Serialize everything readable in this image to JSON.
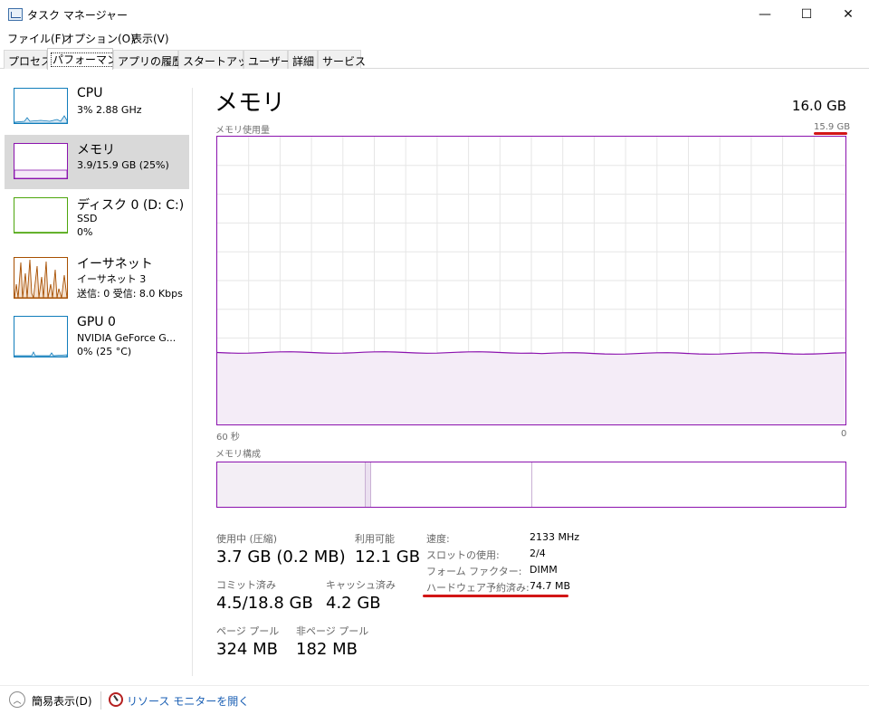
{
  "window": {
    "title": "タスク マネージャー",
    "minimize_glyph": "—",
    "maximize_glyph": "☐",
    "close_glyph": "✕"
  },
  "menu": [
    "ファイル(F)",
    "オプション(O)",
    "表示(V)"
  ],
  "tabs": [
    "プロセス",
    "パフォーマンス",
    "アプリの履歴",
    "スタートアップ",
    "ユーザー",
    "詳細",
    "サービス"
  ],
  "active_tab": "パフォーマンス",
  "sidebar": {
    "items": [
      {
        "title": "CPU",
        "sub1": "3%  2.88 GHz",
        "sub2": "",
        "sub3": "",
        "color": "#117dbb"
      },
      {
        "title": "メモリ",
        "sub1": "3.9/15.9 GB (25%)",
        "sub2": "",
        "sub3": "",
        "color": "#8b12ae"
      },
      {
        "title": "ディスク 0 (D: C:)",
        "sub1": "SSD",
        "sub2": "0%",
        "sub3": "",
        "color": "#4da60c"
      },
      {
        "title": "イーサネット",
        "sub1": "イーサネット 3",
        "sub2": "送信: 0  受信: 8.0 Kbps",
        "sub3": "",
        "color": "#a74f01"
      },
      {
        "title": "GPU 0",
        "sub1": "NVIDIA GeForce G...",
        "sub2": "0% (25 °C)",
        "sub3": "",
        "color": "#117dbb"
      }
    ]
  },
  "main": {
    "title": "メモリ",
    "total": "16.0 GB",
    "usage_label": "メモリ使用量",
    "usage_max": "15.9 GB",
    "x_left": "60 秒",
    "x_right": "0",
    "composition_label": "メモリ構成",
    "usage_fraction": 0.25
  },
  "stats": {
    "in_use_label": "使用中 (圧縮)",
    "in_use_value": "3.7 GB (0.2 MB)",
    "available_label": "利用可能",
    "available_value": "12.1 GB",
    "committed_label": "コミット済み",
    "committed_value": "4.5/18.8 GB",
    "cached_label": "キャッシュ済み",
    "cached_value": "4.2 GB",
    "paged_label": "ページ プール",
    "paged_value": "324 MB",
    "nonpaged_label": "非ページ プール",
    "nonpaged_value": "182 MB"
  },
  "details": [
    {
      "label": "速度:",
      "value": "2133 MHz"
    },
    {
      "label": "スロットの使用:",
      "value": "2/4"
    },
    {
      "label": "フォーム ファクター:",
      "value": "DIMM"
    },
    {
      "label": "ハードウェア予約済み:",
      "value": "74.7 MB"
    }
  ],
  "footer": {
    "fewer_details": "簡易表示(D)",
    "resource_monitor": "リソース モニターを開く"
  },
  "colors": {
    "memory": "#8b12ae",
    "annotation": "#d21616"
  }
}
